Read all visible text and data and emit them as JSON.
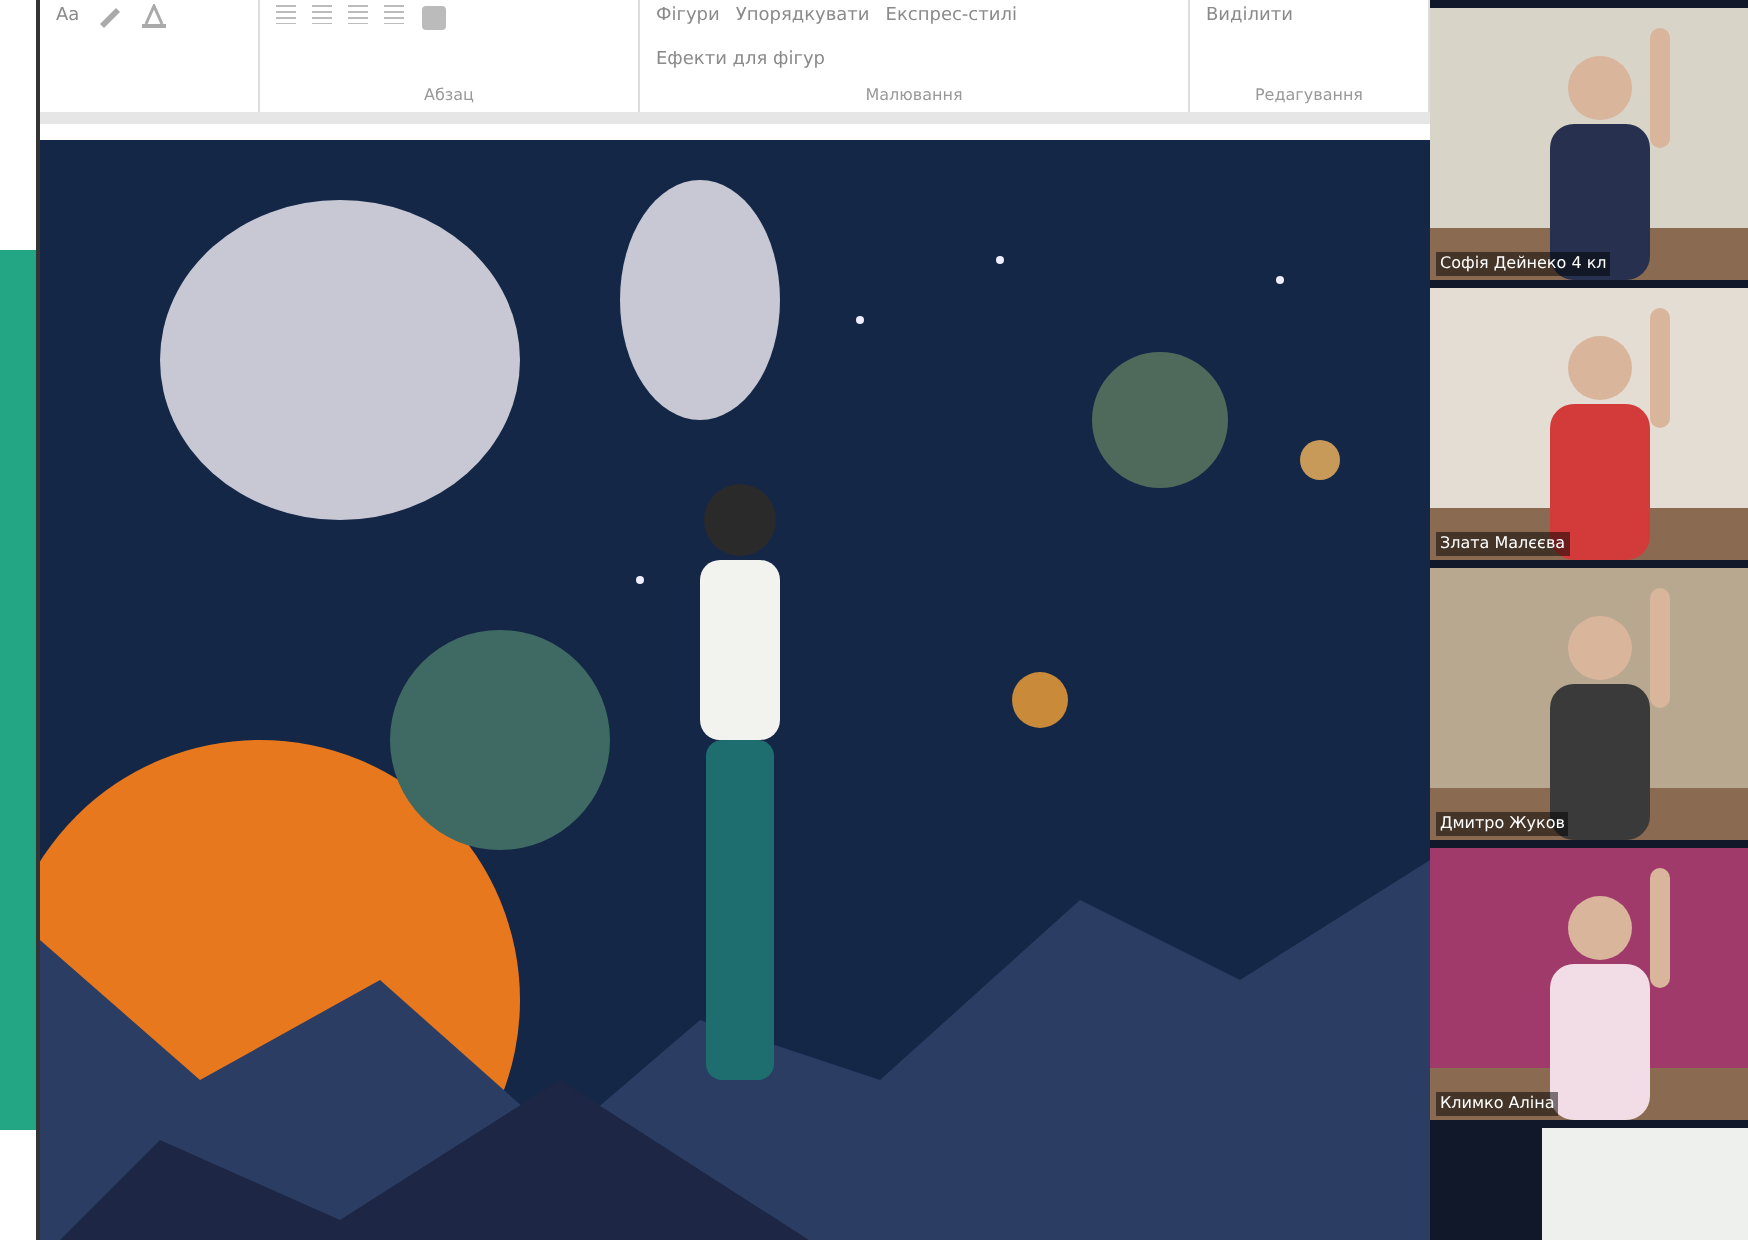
{
  "ribbon": {
    "font_label": "Aa",
    "groups": [
      {
        "label": "Абзац"
      },
      {
        "label": "Малювання",
        "commands": [
          {
            "label": "Фігури"
          },
          {
            "label": "Упорядкувати"
          },
          {
            "label": "Експрес-стилі"
          },
          {
            "label": "Ефекти для фігур"
          }
        ]
      },
      {
        "label": "Редагування",
        "commands": [
          {
            "label": "Виділити"
          }
        ]
      }
    ]
  },
  "participants": [
    {
      "name": "Софія Дейнеко 4 кл"
    },
    {
      "name": "Злата Малєєва"
    },
    {
      "name": "Дмитро Жуков"
    },
    {
      "name": "Климко Аліна"
    }
  ]
}
